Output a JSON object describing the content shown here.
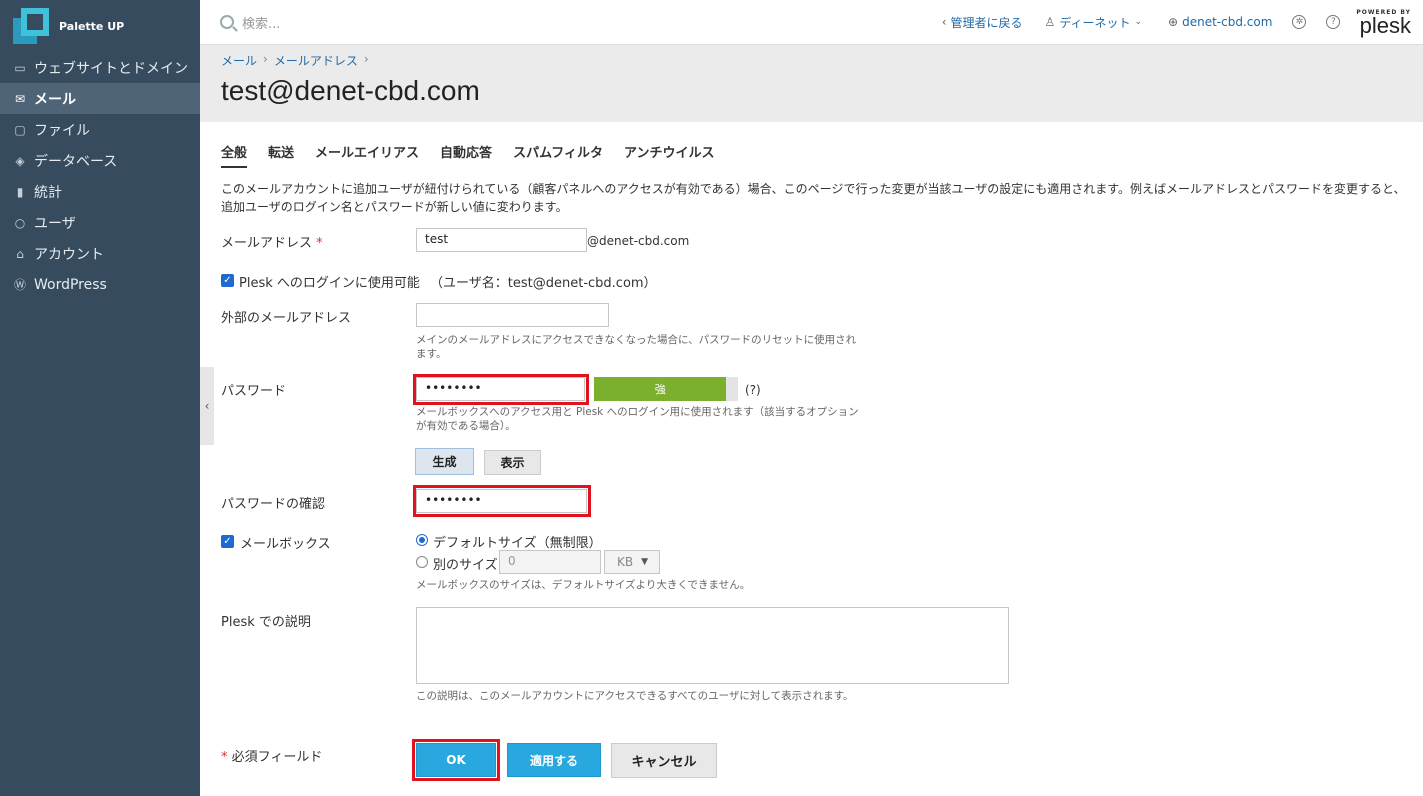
{
  "app": {
    "name": "Palette UP"
  },
  "sidebar": {
    "items": [
      {
        "label": "ウェブサイトとドメイン",
        "icon": "monitor-icon"
      },
      {
        "label": "メール",
        "icon": "mail-icon"
      },
      {
        "label": "ファイル",
        "icon": "folder-icon"
      },
      {
        "label": "データベース",
        "icon": "database-icon"
      },
      {
        "label": "統計",
        "icon": "bar-chart-icon"
      },
      {
        "label": "ユーザ",
        "icon": "user-icon"
      },
      {
        "label": "アカウント",
        "icon": "account-icon"
      },
      {
        "label": "WordPress",
        "icon": "wordpress-icon"
      }
    ]
  },
  "topbar": {
    "search_placeholder": "検索...",
    "back_admin": "管理者に戻る",
    "user_name": "ディーネット",
    "domain": "denet-cbd.com",
    "powered_by": "POWERED BY",
    "brand": "plesk"
  },
  "breadcrumb": [
    "メール",
    "メールアドレス"
  ],
  "page_title": "test@denet-cbd.com",
  "tabs": [
    "全般",
    "転送",
    "メールエイリアス",
    "自動応答",
    "スパムフィルタ",
    "アンチウイルス"
  ],
  "intro": "このメールアカウントに追加ユーザが紐付けられている（顧客パネルへのアクセスが有効である）場合、このページで行った変更が当該ユーザの設定にも適用されます。例えばメールアドレスとパスワードを変更すると、追加ユーザのログイン名とパスワードが新しい値に変わります。",
  "form": {
    "email_label": "メールアドレス",
    "required_mark": "*",
    "email_value": "test",
    "email_domain": "@denet-cbd.com",
    "login_checkbox_label": "Plesk へのログインに使用可能",
    "login_username_note": "（ユーザ名：test@denet-cbd.com）",
    "external_email_label": "外部のメールアドレス",
    "external_email_value": "",
    "external_email_hint": "メインのメールアドレスにアクセスできなくなった場合に、パスワードのリセットに使用されます。",
    "password_label": "パスワード",
    "password_value": "••••••••",
    "strength_label": "強",
    "strength_fraction": 0.92,
    "help_mark": "(?)",
    "password_hint": "メールボックスへのアクセス用と Plesk へのログイン用に使用されます（該当するオプションが有効である場合）。",
    "generate_button": "生成",
    "show_button": "表示",
    "confirm_label": "パスワードの確認",
    "confirm_value": "••••••••",
    "mailbox_label": "メールボックス",
    "default_size_label": "デフォルトサイズ（無制限）",
    "other_size_label": "別のサイズ",
    "other_size_value": "0",
    "size_unit": "KB",
    "mailbox_hint": "メールボックスのサイズは、デフォルトサイズより大きくできません。",
    "description_label": "Plesk での説明",
    "description_hint": "この説明は、このメールアカウントにアクセスできるすべてのユーザに対して表示されます。",
    "required_fields_note": "必須フィールド",
    "ok_button": "OK",
    "apply_button": "適用する",
    "cancel_button": "キャンセル"
  },
  "colors": {
    "sidebar_bg": "#364b5e",
    "accent_blue": "#28a8de",
    "strength_green": "#7ab02d",
    "highlight_red": "#e0121d"
  }
}
